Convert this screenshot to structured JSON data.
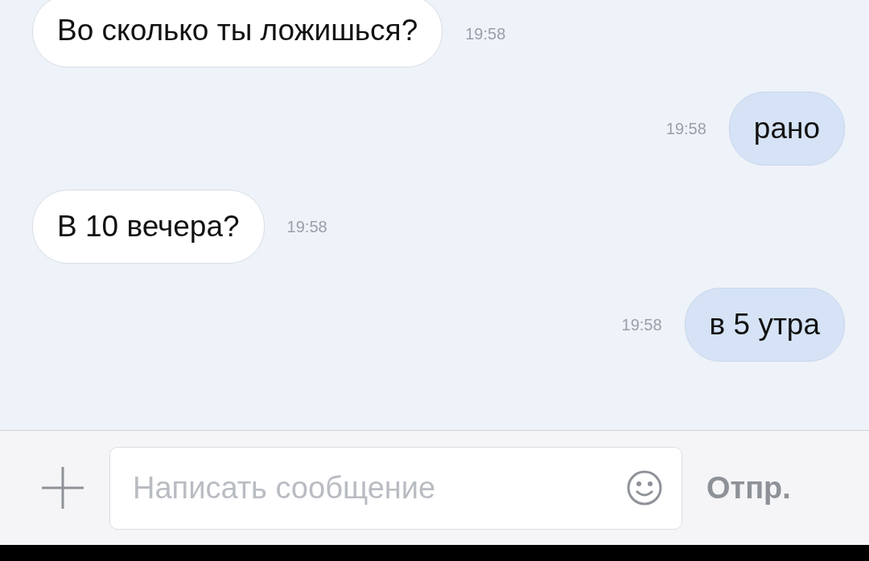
{
  "messages": [
    {
      "kind": "incoming",
      "text": "Во сколько ты ложишься?",
      "time": "19:58"
    },
    {
      "kind": "outgoing",
      "text": "рано",
      "time": "19:58"
    },
    {
      "kind": "incoming",
      "text": "В 10 вечера?",
      "time": "19:58"
    },
    {
      "kind": "outgoing",
      "text": "в 5 утра",
      "time": "19:58"
    }
  ],
  "composer": {
    "placeholder": "Написать сообщение",
    "send": "Отпр."
  }
}
